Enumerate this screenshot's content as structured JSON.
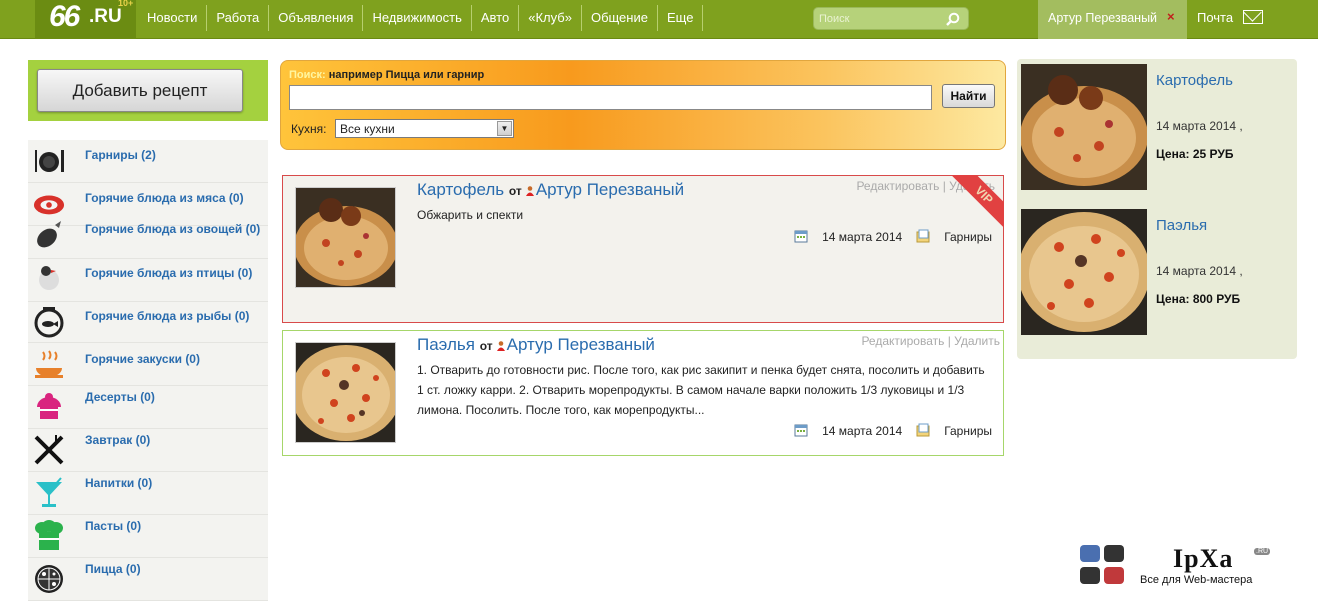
{
  "topbar": {
    "logo_num": "66",
    "logo_ru": ".RU",
    "logo_years": "10+",
    "nav": [
      "Новости",
      "Работа",
      "Объявления",
      "Недвижимость",
      "Авто",
      "«Клуб»",
      "Общение",
      "Еще"
    ],
    "search_placeholder": "Поиск",
    "user_name": "Артур Перезваный",
    "logout_mark": "×",
    "mail_label": "Почта",
    "bar_color": "#7fa11e"
  },
  "sidebar": {
    "add_button": "Добавить рецепт",
    "categories": [
      {
        "label": "Гарниры (2)",
        "icon": "plate-icon"
      },
      {
        "label": "Горячие блюда из мяса (0)",
        "icon": "meat-icon"
      },
      {
        "label": "Горячие блюда из овощей (0)",
        "icon": "eggplant-icon"
      },
      {
        "label": "Горячие блюда из птицы (0)",
        "icon": "chicken-icon"
      },
      {
        "label": "Горячие блюда из рыбы (0)",
        "icon": "fishbowl-icon"
      },
      {
        "label": "Горячие закуски (0)",
        "icon": "hot-dish-icon"
      },
      {
        "label": "Десерты (0)",
        "icon": "cupcake-icon"
      },
      {
        "label": "Завтрак (0)",
        "icon": "cutlery-icon"
      },
      {
        "label": "Напитки (0)",
        "icon": "cocktail-icon"
      },
      {
        "label": "Пасты (0)",
        "icon": "pasta-icon"
      },
      {
        "label": "Пицца (0)",
        "icon": "pizza-icon"
      }
    ]
  },
  "search_panel": {
    "label_prefix": "Поиск:",
    "label_hint": "например Пицца или гарнир",
    "query_value": "",
    "button": "Найти",
    "cuisine_label": "Кухня:",
    "cuisine_selected": "Все кухни"
  },
  "recipes": [
    {
      "title": "Картофель",
      "by": "от",
      "author": "Артур Перезваный",
      "edit": "Редактировать",
      "sep": "|",
      "delete": "Удалить",
      "description": "Обжарить и спекти",
      "date": "14 марта 2014",
      "category": "Гарниры",
      "vip": "VIP"
    },
    {
      "title": "Паэлья",
      "by": "от",
      "author": "Артур Перезваный",
      "edit": "Редактировать",
      "sep": "|",
      "delete": "Удалить",
      "description": "1. Отварить до готовности рис. После того, как рис закипит и пенка будет снята, посолить и добавить 1 ст. ложку карри. 2. Отварить морепродукты. В самом начале варки положить 1/3 луковицы и 1/3 лимона. Посолить. После того, как морепродукты...",
      "date": "14 марта 2014",
      "category": "Гарниры"
    }
  ],
  "right_panel": [
    {
      "title": "Картофель",
      "date": "14 марта 2014 ,",
      "price": "Цена: 25 РУБ"
    },
    {
      "title": "Паэлья",
      "date": "14 марта 2014 ,",
      "price": "Цена: 800 РУБ"
    }
  ],
  "watermark": {
    "brand": "IpXa",
    "tld": ".RU",
    "tagline": "Все для Web-мастера"
  }
}
